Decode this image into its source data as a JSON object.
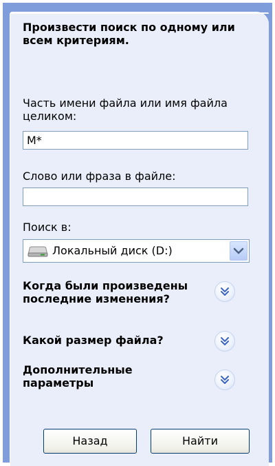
{
  "search": {
    "heading": "Произвести поиск по одному или всем критериям.",
    "filename_label": "Часть имени файла или имя файла целиком:",
    "filename_value": "M*",
    "phrase_label": "Слово или фраза в файле:",
    "phrase_value": "",
    "lookin_label": "Поиск в:",
    "lookin_value": "Локальный диск (D:)"
  },
  "sections": {
    "when_modified": "Когда были произведены последние изменения?",
    "file_size": "Какой размер файла?",
    "advanced": "Дополнительные параметры"
  },
  "buttons": {
    "back": "Назад",
    "search": "Найти"
  },
  "icons": {
    "drive": "hard-drive-icon",
    "dropdown": "chevron-down-icon",
    "expand": "double-chevron-down-icon"
  },
  "colors": {
    "pane_border": "#7f9ddb",
    "pane_background": "#e9eefa",
    "accent": "#3c64c4"
  }
}
